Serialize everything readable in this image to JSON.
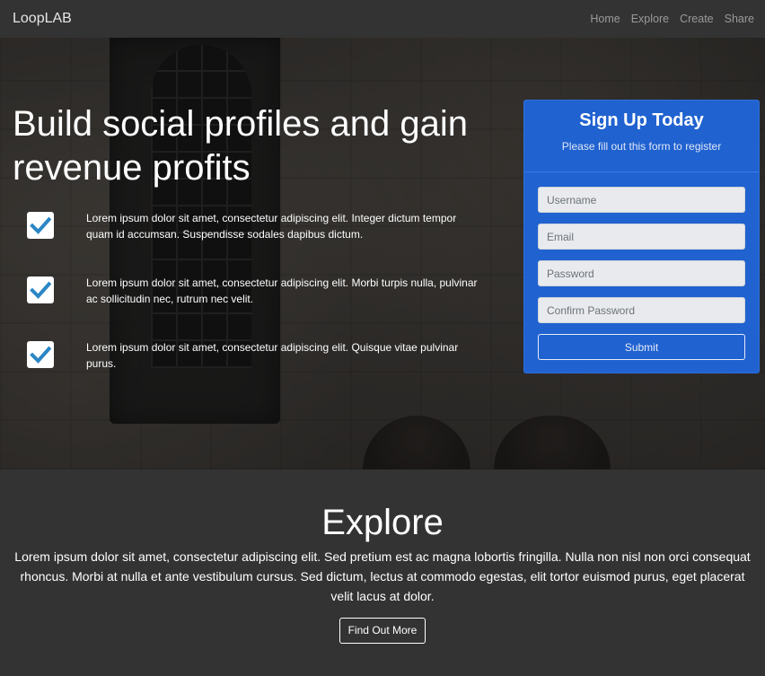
{
  "navbar": {
    "brand": "LoopLAB",
    "links": [
      "Home",
      "Explore",
      "Create",
      "Share"
    ]
  },
  "hero": {
    "title_parts": [
      "Build ",
      "social profiles",
      " and gain revenue ",
      "profits"
    ],
    "features": [
      "Lorem ipsum dolor sit amet, consectetur adipiscing elit. Integer dictum tempor quam id accumsan. Suspendisse sodales dapibus dictum.",
      "Lorem ipsum dolor sit amet, consectetur adipiscing elit. Morbi turpis nulla, pulvinar ac sollicitudin nec, rutrum nec velit.",
      "Lorem ipsum dolor sit amet, consectetur adipiscing elit. Quisque vitae pulvinar purus."
    ],
    "feature_icon": "check-icon",
    "check_color": "#2b86c5"
  },
  "signup": {
    "title": "Sign Up Today",
    "subtitle": "Please fill out this form to register",
    "fields": {
      "username_placeholder": "Username",
      "email_placeholder": "Email",
      "password_placeholder": "Password",
      "confirm_placeholder": "Confirm Password"
    },
    "submit_label": "Submit",
    "accent_color": "#2062d0"
  },
  "explore": {
    "title": "Explore",
    "text": "Lorem ipsum dolor sit amet, consectetur adipiscing elit. Sed pretium est ac magna lobortis fringilla. Nulla non nisl non orci consequat rhoncus. Morbi at nulla et ante vestibulum cursus. Sed dictum, lectus at commodo egestas, elit tortor euismod purus, eget placerat velit lacus at dolor.",
    "button_label": "Find Out More"
  }
}
